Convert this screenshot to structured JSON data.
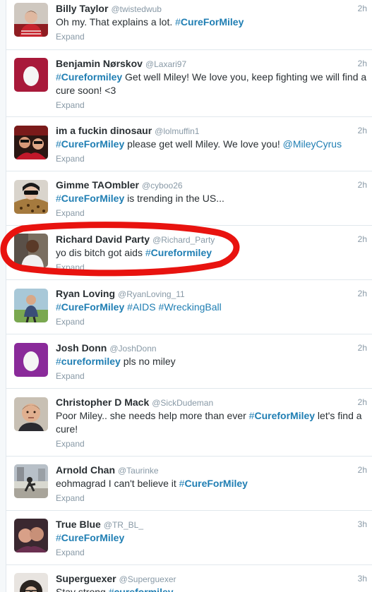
{
  "tweets": [
    {
      "fullname": "Billy Taylor",
      "username": "@twistedwub",
      "time": "2h",
      "parts": [
        {
          "t": "text",
          "v": "Oh my. That explains a lot. "
        },
        {
          "t": "hashtag",
          "v": "CureForMiley"
        }
      ],
      "expand": "Expand",
      "avatar": "photo-person-red-sweater"
    },
    {
      "fullname": "Benjamin Nørskov",
      "username": "@Laxari97",
      "time": "2h",
      "parts": [
        {
          "t": "hashtag",
          "v": "Cureformiley"
        },
        {
          "t": "text",
          "v": " Get well Miley! We love you, keep fighting we will find a cure soon! <3"
        }
      ],
      "expand": "Expand",
      "avatar": "default-egg-red"
    },
    {
      "fullname": "im a fuckin dinosaur",
      "username": "@lolmuffin1",
      "time": "2h",
      "parts": [
        {
          "t": "hashtag",
          "v": "CureForMiley"
        },
        {
          "t": "text",
          "v": " please get well Miley. We love you! "
        },
        {
          "t": "mention",
          "v": "@MileyCyrus"
        }
      ],
      "expand": "Expand",
      "avatar": "photo-two-girls-red"
    },
    {
      "fullname": "Gimme TAOmbler",
      "username": "@cyboo26",
      "time": "2h",
      "parts": [
        {
          "t": "hashtag",
          "v": "CureForMiley"
        },
        {
          "t": "text",
          "v": " is trending in the US..."
        }
      ],
      "expand": "Expand",
      "avatar": "photo-sunglasses-leopard"
    },
    {
      "fullname": "Richard David Party",
      "username": "@Richard_Party",
      "time": "2h",
      "parts": [
        {
          "t": "text",
          "v": "yo dis bitch got aids "
        },
        {
          "t": "hashtag",
          "v": "Cureformiley"
        }
      ],
      "expand": "Expand",
      "avatar": "photo-man-dark-hair"
    },
    {
      "fullname": "Ryan Loving",
      "username": "@RyanLoving_11",
      "time": "2h",
      "parts": [
        {
          "t": "hashtag",
          "v": "CureForMiley"
        },
        {
          "t": "text",
          "v": " "
        },
        {
          "t": "hashtag",
          "v": "AIDS"
        },
        {
          "t": "text",
          "v": " "
        },
        {
          "t": "hashtag",
          "v": "WreckingBall"
        }
      ],
      "expand": "Expand",
      "avatar": "photo-man-outdoors"
    },
    {
      "fullname": "Josh Donn",
      "username": "@JoshDonn",
      "time": "2h",
      "parts": [
        {
          "t": "hashtag",
          "v": "cureformiley"
        },
        {
          "t": "text",
          "v": " pls no miley"
        }
      ],
      "expand": "Expand",
      "avatar": "default-egg-purple"
    },
    {
      "fullname": "Christopher D Mack",
      "username": "@SickDudeman",
      "time": "2h",
      "parts": [
        {
          "t": "text",
          "v": "Poor Miley.. she needs help more than ever "
        },
        {
          "t": "hashtag",
          "v": "CureforMiley"
        },
        {
          "t": "text",
          "v": " let's find a cure!"
        }
      ],
      "expand": "Expand",
      "avatar": "photo-man-face"
    },
    {
      "fullname": "Arnold Chan",
      "username": "@Taurinke",
      "time": "2h",
      "parts": [
        {
          "t": "text",
          "v": "eohmagrad I can't believe it "
        },
        {
          "t": "hashtag",
          "v": "CureForMiley"
        }
      ],
      "expand": "Expand",
      "avatar": "photo-street-skater"
    },
    {
      "fullname": "True Blue",
      "username": "@TR_BL_",
      "time": "3h",
      "parts": [
        {
          "t": "hashtag",
          "v": "CureForMiley"
        }
      ],
      "expand": "Expand",
      "avatar": "photo-couple-selfie"
    },
    {
      "fullname": "Superguexer",
      "username": "@Superguexer",
      "time": "3h",
      "parts": [
        {
          "t": "text",
          "v": "Stay strong "
        },
        {
          "t": "hashtag",
          "v": "cureformiley"
        }
      ],
      "expand": "",
      "avatar": "photo-curly-hair-glasses"
    }
  ],
  "colors": {
    "link": "#1f7eb3",
    "annotation": "#e8130f",
    "meta": "#8899a6",
    "text": "#292f33"
  }
}
